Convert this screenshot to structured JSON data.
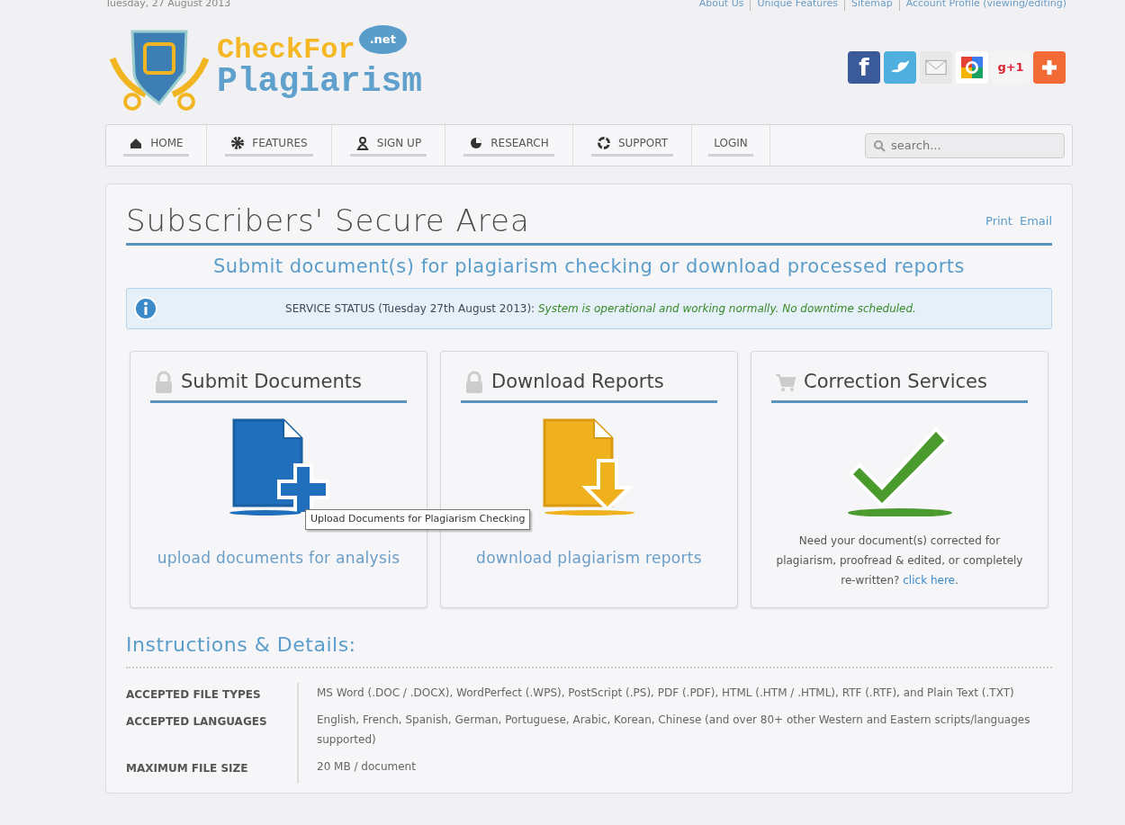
{
  "top_bar": {
    "date": "Tuesday, 27 August 2013",
    "links": [
      "About Us",
      "Unique Features",
      "Sitemap",
      "Account Profile (viewing/editing)"
    ]
  },
  "logo": {
    "line1": "CheckFor",
    "line2": "Plagiarism",
    "badge": ".net"
  },
  "share_buttons": [
    {
      "kind": "facebook",
      "label": "f"
    },
    {
      "kind": "twitter"
    },
    {
      "kind": "email"
    },
    {
      "kind": "google"
    },
    {
      "kind": "plusone",
      "label": "g+1"
    },
    {
      "kind": "addthis"
    }
  ],
  "nav": [
    {
      "label": "HOME",
      "kind": "home"
    },
    {
      "label": "FEATURES",
      "kind": "features"
    },
    {
      "label": "SIGN UP",
      "kind": "signup"
    },
    {
      "label": "RESEARCH",
      "kind": "research"
    },
    {
      "label": "SUPPORT",
      "kind": "support"
    },
    {
      "label": "LOGIN",
      "kind": "login"
    }
  ],
  "search": {
    "placeholder": "search..."
  },
  "page_title": "Subscribers' Secure Area",
  "page_actions": [
    "Print",
    "Email"
  ],
  "subtitle": "Submit document(s) for plagiarism checking or download processed reports",
  "status": {
    "label": "SERVICE STATUS (Tuesday 27th August 2013):",
    "message": "System is operational and working normally. No downtime scheduled."
  },
  "panels": [
    {
      "kind": "upload",
      "title": "Submit Documents",
      "link": "upload documents for analysis"
    },
    {
      "kind": "download",
      "title": "Download Reports",
      "link": "download plagiarism reports"
    },
    {
      "kind": "correction",
      "title": "Correction Services",
      "text_before": "Need your document(s) corrected for plagiarism, proofread & edited, or completely re-written? ",
      "link": "click here",
      "text_after": "."
    }
  ],
  "tooltip": "Upload Documents for Plagiarism Checking",
  "instructions": {
    "title": "Instructions & Details:",
    "rows": [
      {
        "label": "ACCEPTED FILE TYPES",
        "value": "MS Word (.DOC / .DOCX), WordPerfect (.WPS), PostScript (.PS), PDF (.PDF), HTML (.HTM / .HTML), RTF (.RTF), and Plain Text (.TXT)"
      },
      {
        "label": "ACCEPTED LANGUAGES",
        "value": "English, French, Spanish, German, Portuguese, Arabic, Korean, Chinese (and over 80+ other Western and Eastern scripts/languages supported)"
      },
      {
        "label": "MAXIMUM FILE SIZE",
        "value": "20 MB / document"
      }
    ]
  }
}
